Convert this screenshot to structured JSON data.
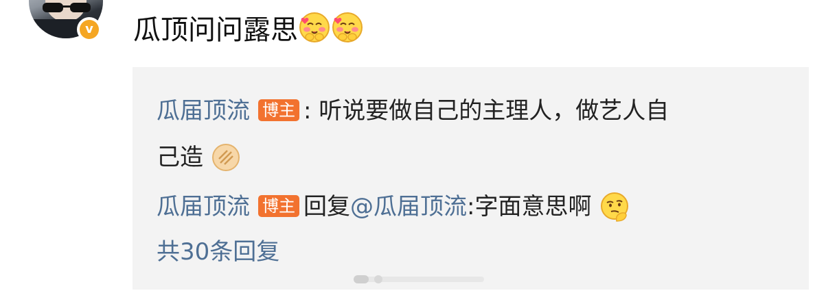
{
  "post": {
    "comment_text": "瓜顶问问露思",
    "comment_emoji": [
      "blush-heart-icon",
      "blush-heart-icon"
    ],
    "verified_badge": "v"
  },
  "replies": {
    "items": [
      {
        "author": "瓜届顶流",
        "badge": "博主",
        "text_line1": ": 听说要做自己的主理人，做艺人自",
        "text_line2": "己造",
        "emoji": "crackers-icon"
      },
      {
        "author": "瓜届顶流",
        "badge": "博主",
        "reply_prefix": "回复",
        "mention": "@瓜届顶流",
        "text": ":字面意思啊",
        "emoji": "thinking-face-icon"
      }
    ],
    "more_link": "共30条回复"
  },
  "colors": {
    "name_link": "#4e6f94",
    "badge_bg": "#f2722f",
    "reply_box_bg": "#f3f3f3",
    "verified": "#f5a623"
  }
}
